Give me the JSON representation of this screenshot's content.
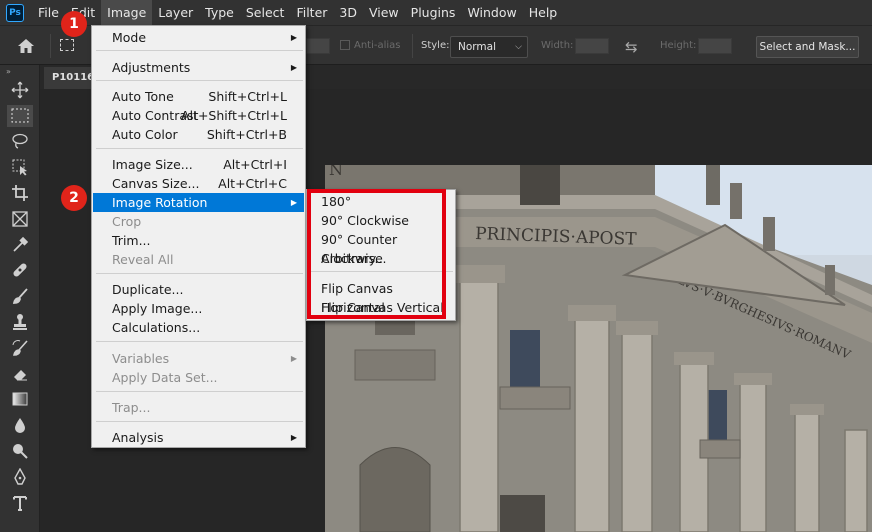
{
  "menubar": {
    "logo": "Ps",
    "items": [
      "File",
      "Edit",
      "Image",
      "Layer",
      "Type",
      "Select",
      "Filter",
      "3D",
      "View",
      "Plugins",
      "Window",
      "Help"
    ],
    "active_index": 2
  },
  "options": {
    "anti_alias": "Anti-alias",
    "style_label": "Style:",
    "style_value": "Normal",
    "width_label": "Width:",
    "height_label": "Height:",
    "select_mask": "Select and Mask..."
  },
  "document": {
    "tab_title": "P10116"
  },
  "tools": [
    "move-tool-icon",
    "rect-marquee-tool-icon",
    "lasso-tool-icon",
    "object-select-tool-icon",
    "crop-tool-icon",
    "frame-tool-icon",
    "eyedropper-tool-icon",
    "healing-brush-tool-icon",
    "brush-tool-icon",
    "clone-stamp-tool-icon",
    "history-brush-tool-icon",
    "eraser-tool-icon",
    "gradient-tool-icon",
    "blur-tool-icon",
    "dodge-tool-icon",
    "pen-tool-icon",
    "type-tool-icon"
  ],
  "image_menu": {
    "items": [
      {
        "label": "Mode",
        "submenu": true
      },
      {
        "label": "Adjustments",
        "submenu": true
      },
      {
        "label": "Auto Tone",
        "shortcut": "Shift+Ctrl+L"
      },
      {
        "label": "Auto Contrast",
        "shortcut": "Alt+Shift+Ctrl+L"
      },
      {
        "label": "Auto Color",
        "shortcut": "Shift+Ctrl+B"
      },
      {
        "label": "Image Size...",
        "shortcut": "Alt+Ctrl+I"
      },
      {
        "label": "Canvas Size...",
        "shortcut": "Alt+Ctrl+C"
      },
      {
        "label": "Image Rotation",
        "submenu": true,
        "highlighted": true
      },
      {
        "label": "Crop",
        "disabled": true
      },
      {
        "label": "Trim..."
      },
      {
        "label": "Reveal All",
        "disabled": true
      },
      {
        "label": "Duplicate..."
      },
      {
        "label": "Apply Image..."
      },
      {
        "label": "Calculations..."
      },
      {
        "label": "Variables",
        "submenu": true,
        "disabled": true
      },
      {
        "label": "Apply Data Set...",
        "disabled": true
      },
      {
        "label": "Trap...",
        "disabled": true
      },
      {
        "label": "Analysis",
        "submenu": true
      }
    ]
  },
  "rotation_submenu": {
    "items": [
      "180°",
      "90° Clockwise",
      "90° Counter Clockwise",
      "Arbitrary...",
      "Flip Canvas Horizontal",
      "Flip Canvas Vertical"
    ]
  },
  "badges": {
    "step1": "1",
    "step2": "2"
  },
  "photo": {
    "inscription_1": "PRINCIPIS·APOST",
    "inscription_2": "PAVLVS·V·BVRGHESIVS·ROMANV",
    "inscription_3": "N"
  },
  "colors": {
    "highlight": "#0078d7",
    "callout": "#e2000f",
    "badge": "#e0241a"
  }
}
